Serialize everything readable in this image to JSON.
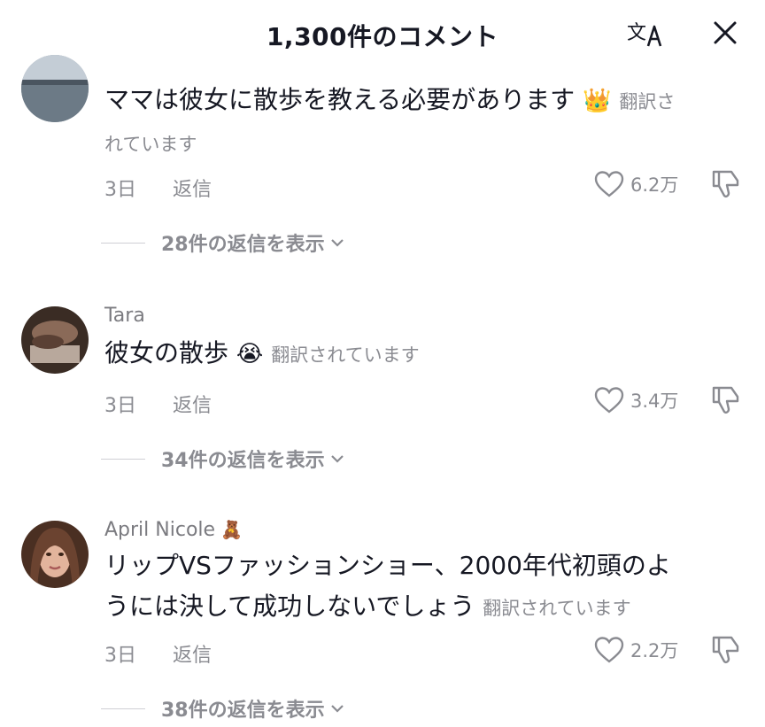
{
  "header": {
    "title": "1,300件のコメント",
    "translate_icon": "translate-icon",
    "close_icon": "close-icon"
  },
  "comments": [
    {
      "username": "",
      "text": "ママは彼女に散歩を教える必要があります",
      "emoji": "👑",
      "translated_label": "翻訳さ",
      "translated_label_cont": "れています",
      "time": "3日",
      "reply_label": "返信",
      "likes": "6.2万",
      "view_replies": "28件の返信を表示"
    },
    {
      "username": "Tara",
      "text": "彼女の散歩",
      "emoji": "😭",
      "translated_label": "翻訳されています",
      "time": "3日",
      "reply_label": "返信",
      "likes": "3.4万",
      "view_replies": "34件の返信を表示"
    },
    {
      "username": "April Nicole",
      "username_emoji": "🧸",
      "text_line1": "リップVSファッションショー、2000年代初頭のよ",
      "text_line2": "うには決して成功しないでしょう",
      "translated_label": "翻訳されています",
      "time": "3日",
      "reply_label": "返信",
      "likes": "2.2万",
      "view_replies": "38件の返信を表示"
    }
  ],
  "colors": {
    "text": "#161823",
    "secondary": "#8a8b91",
    "username": "#7b7b80"
  }
}
